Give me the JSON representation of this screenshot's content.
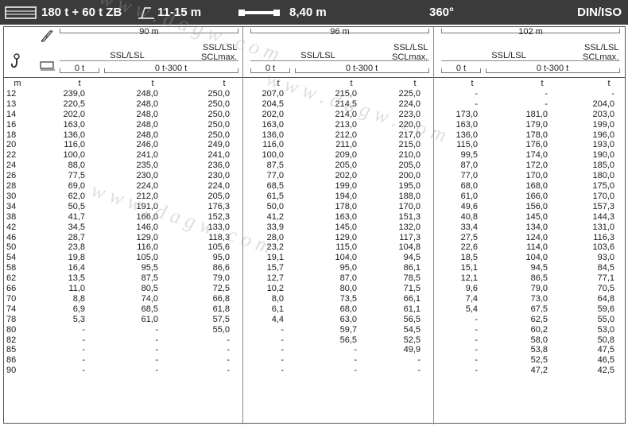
{
  "topbar": {
    "capacity": "180 t + 60 t ZB",
    "base_range": "11-15 m",
    "width": "8,40 m",
    "slew": "360°",
    "standard": "DIN/ISO"
  },
  "header": {
    "groups": [
      {
        "boom": "90 m",
        "ssl": "SSL/LSL",
        "scl_top": "SSL/LSL",
        "scl_bottom": "SCLmax.",
        "zero": "0 t",
        "range": "0 t-300 t"
      },
      {
        "boom": "96 m",
        "ssl": "SSL/LSL",
        "scl_top": "SSL/LSL",
        "scl_bottom": "SCLmax.",
        "zero": "0 t",
        "range": "0 t-300 t"
      },
      {
        "boom": "102 m",
        "ssl": "SSL/LSL",
        "scl_top": "SSL/LSL",
        "scl_bottom": "SCLmax.",
        "zero": "0 t",
        "range": "0 t-300 t"
      }
    ]
  },
  "units": {
    "radius": "m",
    "load": "t"
  },
  "rows": [
    {
      "m": "12",
      "v": [
        "239,0",
        "248,0",
        "250,0",
        "207,0",
        "215,0",
        "225,0",
        "-",
        "-",
        "-"
      ]
    },
    {
      "m": "13",
      "v": [
        "220,5",
        "248,0",
        "250,0",
        "204,5",
        "214,5",
        "224,0",
        "-",
        "-",
        "204,0"
      ]
    },
    {
      "m": "14",
      "v": [
        "202,0",
        "248,0",
        "250,0",
        "202,0",
        "214,0",
        "223,0",
        "173,0",
        "181,0",
        "203,0"
      ]
    },
    {
      "m": "16",
      "v": [
        "163,0",
        "248,0",
        "250,0",
        "163,0",
        "213,0",
        "220,0",
        "163,0",
        "179,0",
        "199,0"
      ]
    },
    {
      "m": "18",
      "v": [
        "136,0",
        "248,0",
        "250,0",
        "136,0",
        "212,0",
        "217,0",
        "136,0",
        "178,0",
        "196,0"
      ]
    },
    {
      "m": "20",
      "v": [
        "116,0",
        "246,0",
        "249,0",
        "116,0",
        "211,0",
        "215,0",
        "115,0",
        "176,0",
        "193,0"
      ]
    },
    {
      "m": "22",
      "v": [
        "100,0",
        "241,0",
        "241,0",
        "100,0",
        "209,0",
        "210,0",
        "99,5",
        "174,0",
        "190,0"
      ]
    },
    {
      "m": "24",
      "v": [
        "88,0",
        "235,0",
        "236,0",
        "87,5",
        "205,0",
        "205,0",
        "87,0",
        "172,0",
        "185,0"
      ]
    },
    {
      "m": "26",
      "v": [
        "77,5",
        "230,0",
        "230,0",
        "77,0",
        "202,0",
        "200,0",
        "77,0",
        "170,0",
        "180,0"
      ]
    },
    {
      "m": "28",
      "v": [
        "69,0",
        "224,0",
        "224,0",
        "68,5",
        "199,0",
        "195,0",
        "68,0",
        "168,0",
        "175,0"
      ]
    },
    {
      "m": "30",
      "v": [
        "62,0",
        "212,0",
        "205,0",
        "61,5",
        "194,0",
        "188,0",
        "61,0",
        "166,0",
        "170,0"
      ]
    },
    {
      "m": "34",
      "v": [
        "50,5",
        "191,0",
        "176,3",
        "50,0",
        "178,0",
        "170,0",
        "49,6",
        "156,0",
        "157,3"
      ]
    },
    {
      "m": "38",
      "v": [
        "41,7",
        "166,0",
        "152,3",
        "41,2",
        "163,0",
        "151,3",
        "40,8",
        "145,0",
        "144,3"
      ]
    },
    {
      "m": "42",
      "v": [
        "34,5",
        "146,0",
        "133,0",
        "33,9",
        "145,0",
        "132,0",
        "33,4",
        "134,0",
        "131,0"
      ]
    },
    {
      "m": "46",
      "v": [
        "28,7",
        "129,0",
        "118,3",
        "28,0",
        "129,0",
        "117,3",
        "27,5",
        "124,0",
        "116,3"
      ]
    },
    {
      "m": "50",
      "v": [
        "23,8",
        "116,0",
        "105,6",
        "23,2",
        "115,0",
        "104,8",
        "22,6",
        "114,0",
        "103,6"
      ]
    },
    {
      "m": "54",
      "v": [
        "19,8",
        "105,0",
        "95,0",
        "19,1",
        "104,0",
        "94,5",
        "18,5",
        "104,0",
        "93,0"
      ]
    },
    {
      "m": "58",
      "v": [
        "16,4",
        "95,5",
        "86,6",
        "15,7",
        "95,0",
        "86,1",
        "15,1",
        "94,5",
        "84,5"
      ]
    },
    {
      "m": "62",
      "v": [
        "13,5",
        "87,5",
        "79,0",
        "12,7",
        "87,0",
        "78,5",
        "12,1",
        "86,5",
        "77,1"
      ]
    },
    {
      "m": "66",
      "v": [
        "11,0",
        "80,5",
        "72,5",
        "10,2",
        "80,0",
        "71,5",
        "9,6",
        "79,0",
        "70,5"
      ]
    },
    {
      "m": "70",
      "v": [
        "8,8",
        "74,0",
        "66,8",
        "8,0",
        "73,5",
        "66,1",
        "7,4",
        "73,0",
        "64,8"
      ]
    },
    {
      "m": "74",
      "v": [
        "6,9",
        "68,5",
        "61,8",
        "6,1",
        "68,0",
        "61,1",
        "5,4",
        "67,5",
        "59,6"
      ]
    },
    {
      "m": "78",
      "v": [
        "5,3",
        "61,0",
        "57,5",
        "4,4",
        "63,0",
        "56,5",
        "-",
        "62,5",
        "55,0"
      ]
    },
    {
      "m": "80",
      "v": [
        "-",
        "-",
        "55,0",
        "-",
        "59,7",
        "54,5",
        "-",
        "60,2",
        "53,0"
      ]
    },
    {
      "m": "82",
      "v": [
        "-",
        "-",
        "-",
        "-",
        "56,5",
        "52,5",
        "-",
        "58,0",
        "50,8"
      ]
    },
    {
      "m": "85",
      "v": [
        "-",
        "-",
        "-",
        "-",
        "-",
        "49,9",
        "-",
        "53,8",
        "47,5"
      ]
    },
    {
      "m": "86",
      "v": [
        "-",
        "-",
        "-",
        "-",
        "-",
        "-",
        "-",
        "52,5",
        "46,5"
      ]
    },
    {
      "m": "90",
      "v": [
        "-",
        "-",
        "-",
        "-",
        "-",
        "-",
        "-",
        "47,2",
        "42,5"
      ]
    }
  ],
  "colors": {
    "topbar_bg": "#3b3b3b",
    "text": "#1a1a1a",
    "lines": "#555555"
  },
  "icons": [
    "table-icon",
    "outrigger-icon",
    "counterweight-bar-icon",
    "boom-icon",
    "hook-icon",
    "hoist-icon"
  ]
}
